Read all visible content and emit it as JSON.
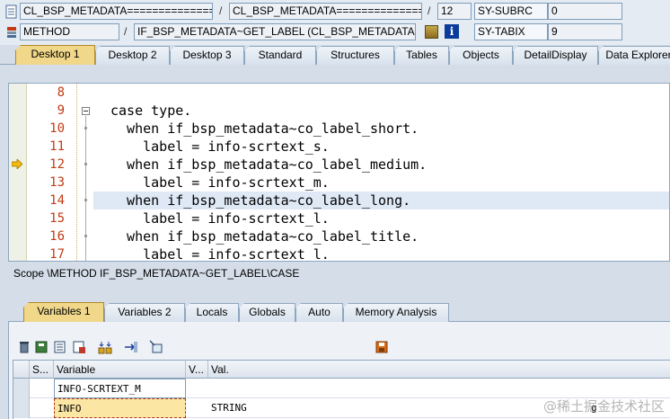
{
  "header": {
    "program_field": "CL_BSP_METADATA===============",
    "include_field": "CL_BSP_METADATA===============",
    "line_field": "12",
    "var1_name": "SY-SUBRC",
    "var1_value": "0",
    "event_type": "METHOD",
    "event_name": "IF_BSP_METADATA~GET_LABEL (CL_BSP_METADATA)",
    "var2_name": "SY-TABIX",
    "var2_value": "9",
    "separator": "/"
  },
  "desktop_tabs": [
    "Desktop 1",
    "Desktop 2",
    "Desktop 3",
    "Standard",
    "Structures",
    "Tables",
    "Objects",
    "DetailDisplay",
    "Data Explorer"
  ],
  "active_desktop_tab": "Desktop 1",
  "code_lines": [
    {
      "num": "8",
      "code": ""
    },
    {
      "num": "9",
      "code": "case type."
    },
    {
      "num": "10",
      "code": "  when if_bsp_metadata~co_label_short."
    },
    {
      "num": "11",
      "code": "    label = info-scrtext_s."
    },
    {
      "num": "12",
      "code": "  when if_bsp_metadata~co_label_medium."
    },
    {
      "num": "13",
      "code": "    label = info-scrtext_m."
    },
    {
      "num": "14",
      "code": "  when if_bsp_metadata~co_label_long."
    },
    {
      "num": "15",
      "code": "    label = info-scrtext_l."
    },
    {
      "num": "16",
      "code": "  when if_bsp_metadata~co_label_title."
    },
    {
      "num": "17",
      "code": "    label = info-scrtext_l."
    }
  ],
  "current_line": "12",
  "highlighted_line": "14",
  "scope_text": "Scope \\METHOD IF_BSP_METADATA~GET_LABEL\\CASE",
  "variable_tabs": [
    "Variables 1",
    "Variables 2",
    "Locals",
    "Globals",
    "Auto",
    "Memory Analysis"
  ],
  "active_variable_tab": "Variables 1",
  "toolbar_icons": [
    "delete-icon",
    "save-layout-icon",
    "display-icon",
    "change-icon",
    "split-icon",
    "transfer-icon",
    "select-icon",
    "save-icon"
  ],
  "grid": {
    "columns": [
      "S...",
      "Variable",
      "V...",
      "Val."
    ],
    "rows": [
      {
        "variable": "INFO-SCRTEXT_M",
        "value": ""
      },
      {
        "variable": "INFO",
        "value": "STRING"
      }
    ],
    "value_cell_extra": "g"
  },
  "watermark": "@稀土掘金技术社区",
  "colors": {
    "active_tab": "#f0d78a",
    "line_number": "#c23b14",
    "keyword": "#0000aa",
    "highlight_row": "#dfe9f6"
  }
}
